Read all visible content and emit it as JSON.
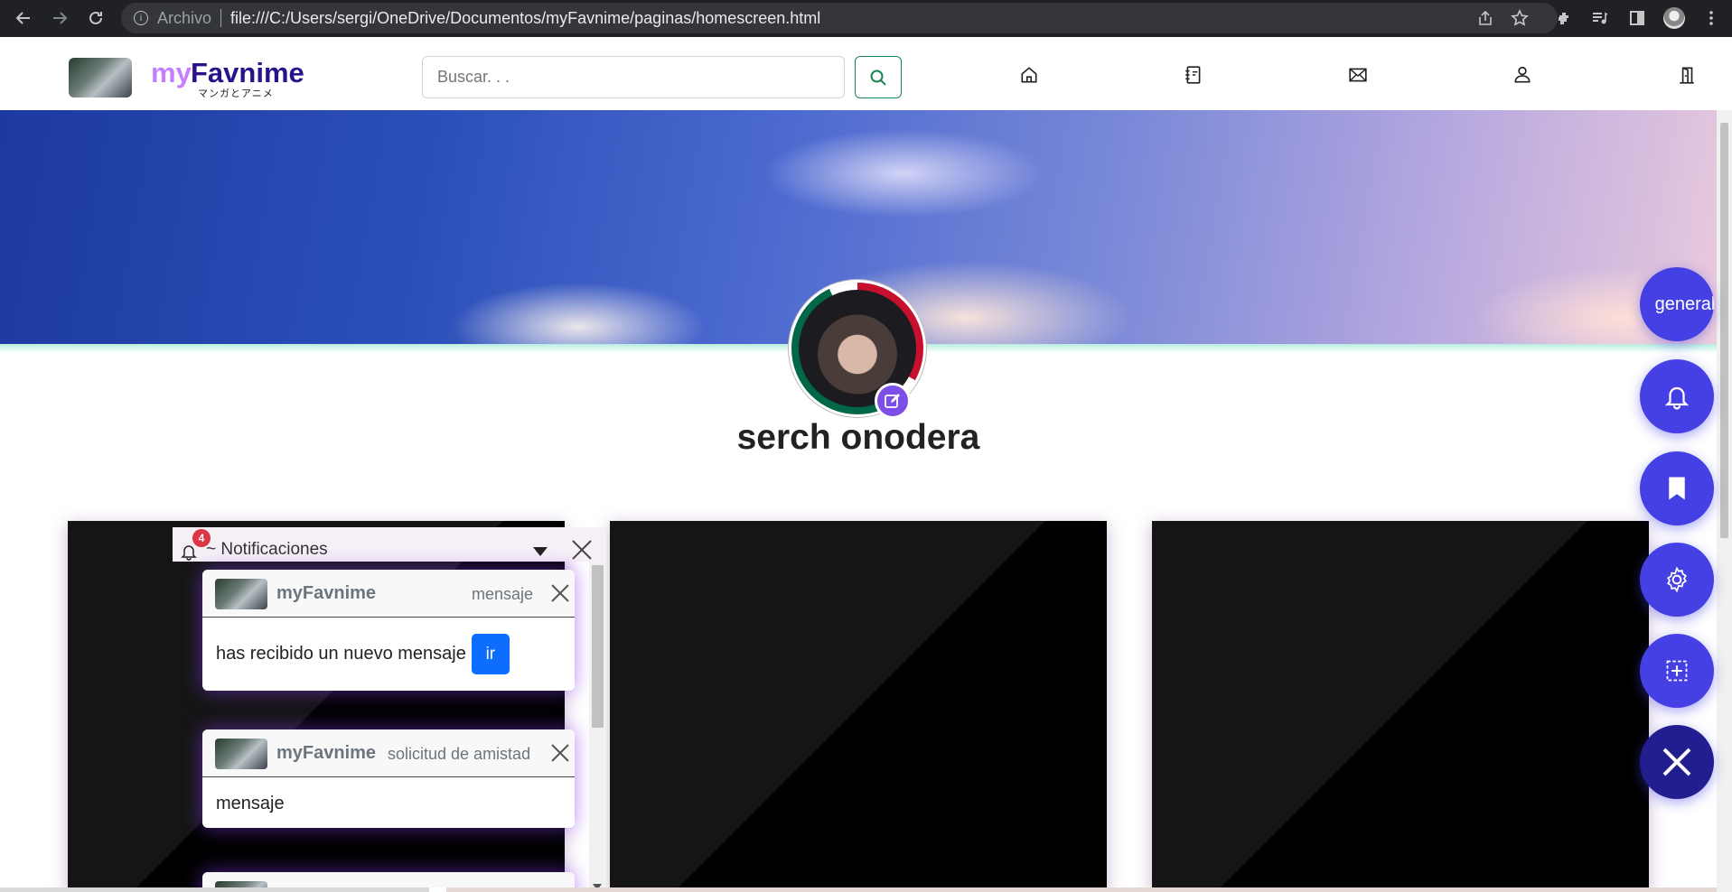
{
  "browser": {
    "url_prefix": "Archivo",
    "url": "file:///C:/Users/sergi/OneDrive/Documentos/myFavnime/paginas/homescreen.html",
    "icons": [
      "back-icon",
      "forward-icon",
      "reload-icon",
      "info-icon",
      "share-icon",
      "star-icon",
      "extensions-icon",
      "media-icon",
      "sidebar-icon",
      "profile-icon",
      "menu-icon"
    ]
  },
  "header": {
    "logo_my": "my",
    "logo_favnime": "Favnime",
    "logo_subtitle": "マンガとアニメ",
    "search": {
      "placeholder": "Buscar. . ."
    },
    "nav_icons": [
      "home-icon",
      "journal-icon",
      "mail-icon",
      "person-icon",
      "door-icon"
    ]
  },
  "profile": {
    "name": "serch onodera"
  },
  "notifications": {
    "count": "4",
    "title": "~ Notificaciones",
    "items": [
      {
        "app": "myFavnime",
        "tag": "mensaje",
        "body": "has recibido un nuevo mensaje",
        "action": "ir"
      },
      {
        "app": "myFavnime",
        "tag": "solicitud de amistad",
        "body": "mensaje"
      }
    ]
  },
  "fabs": {
    "general_label": "general",
    "icons": [
      "bell-icon",
      "bookmark-icon",
      "gear-icon",
      "add-icon",
      "close-icon"
    ]
  },
  "colors": {
    "fab": "#4540e4",
    "fab_close": "#221e8f",
    "accent_purple": "#c77dff",
    "brand_navy": "#2a138a",
    "search_green": "#198754",
    "ir_button": "#0d6efd",
    "badge_red": "#dc3545"
  }
}
